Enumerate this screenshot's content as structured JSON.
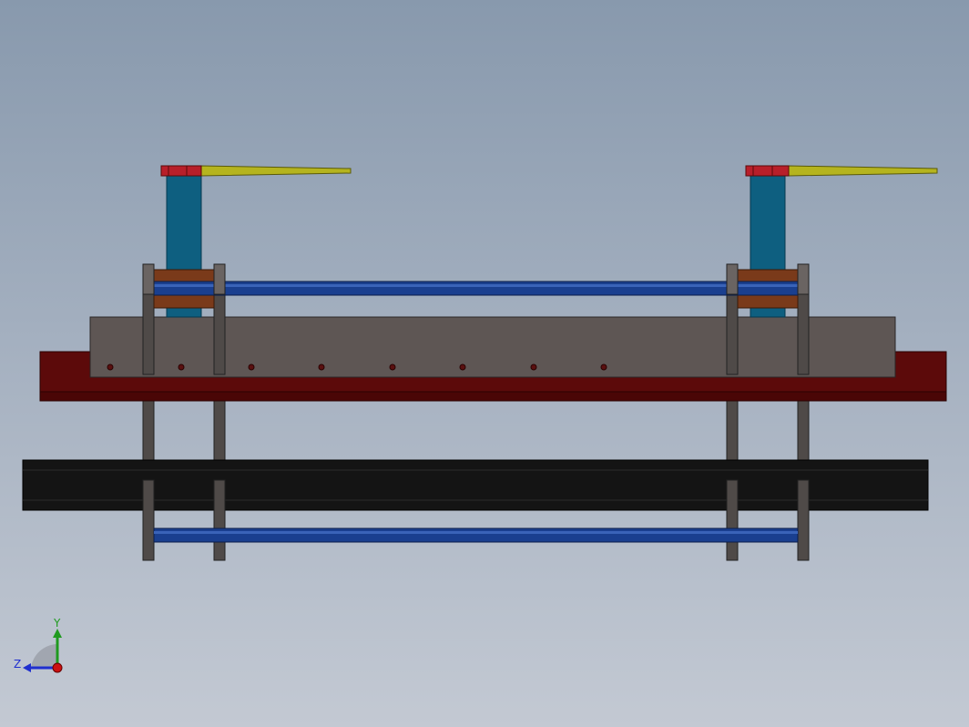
{
  "viewport": {
    "background_top": "#8899ad",
    "background_bottom": "#c3c9d3"
  },
  "colors": {
    "base_plate": "#5c0a0a",
    "base_plate_edge": "#3a0404",
    "gray_block": "#5e5654",
    "black_beam": "#141414",
    "column": "#0e5f80",
    "rod": "#1a3f8f",
    "clamp_block": "#7a3a1a",
    "arm": "#b5b41e",
    "arm_head": "#b81f2a",
    "bracket": "#4f4a48"
  },
  "triad": {
    "y_label": "Y",
    "z_label": "Z",
    "y_color": "#1f9a1f",
    "z_color": "#1f2fcf",
    "x_color": "#cc1111"
  }
}
